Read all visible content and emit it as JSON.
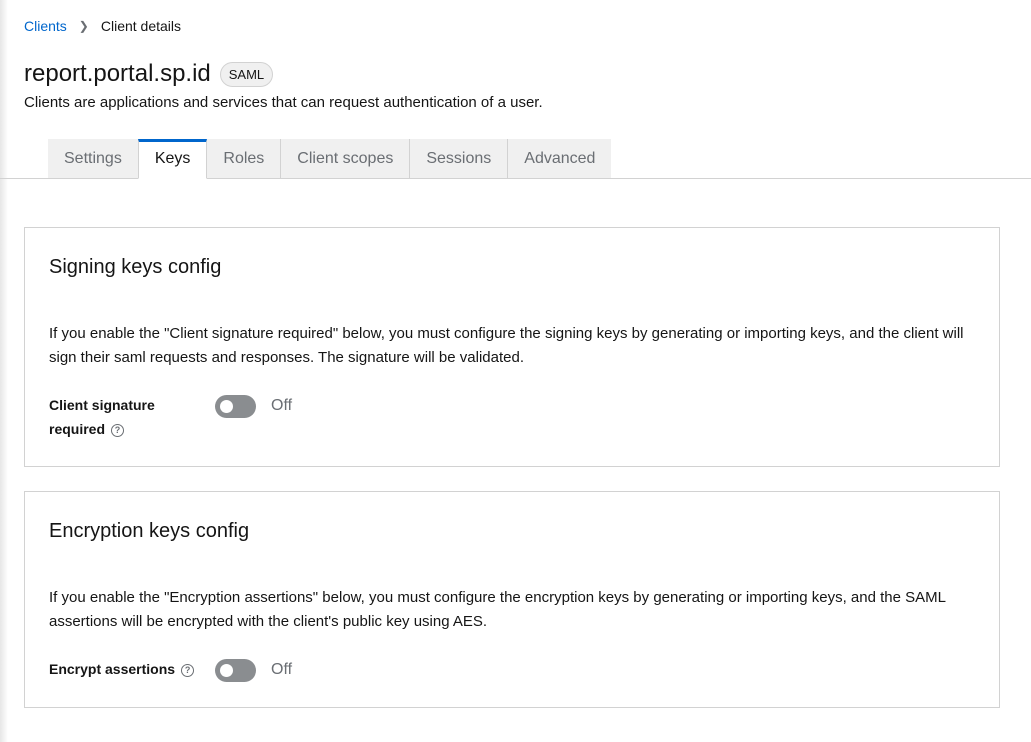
{
  "breadcrumb": {
    "items": [
      {
        "label": "Clients",
        "link": true
      },
      {
        "label": "Client details",
        "link": false
      }
    ],
    "separator_icon": "chevron-right-icon"
  },
  "header": {
    "title": "report.portal.sp.id",
    "badge": "SAML",
    "subtitle": "Clients are applications and services that can request authentication of a user."
  },
  "tabs": [
    {
      "label": "Settings",
      "active": false
    },
    {
      "label": "Keys",
      "active": true
    },
    {
      "label": "Roles",
      "active": false
    },
    {
      "label": "Client scopes",
      "active": false
    },
    {
      "label": "Sessions",
      "active": false
    },
    {
      "label": "Advanced",
      "active": false
    }
  ],
  "signing_card": {
    "title": "Signing keys config",
    "description": "If you enable the \"Client signature required\" below, you must configure the signing keys by generating or importing keys, and the client will sign their saml requests and responses. The signature will be validated.",
    "field_label": "Client signature required",
    "help_icon": "question-circle-icon",
    "switch_on": false,
    "switch_text": "Off"
  },
  "encryption_card": {
    "title": "Encryption keys config",
    "description": "If you enable the \"Encryption assertions\" below, you must configure the encryption keys by generating or importing keys, and the SAML assertions will be encrypted with the client's public key using AES.",
    "field_label": "Encrypt assertions",
    "help_icon": "question-circle-icon",
    "switch_on": false,
    "switch_text": "Off"
  },
  "colors": {
    "link": "#0066cc",
    "active_tab_border": "#0066cc",
    "switch_off": "#8a8d90"
  }
}
